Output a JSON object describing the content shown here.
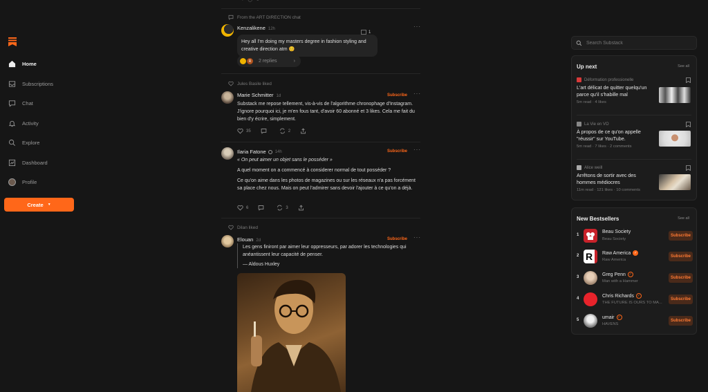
{
  "colors": {
    "accent": "#ff6719",
    "background": "#161616",
    "card": "#1c1c1c"
  },
  "nav": {
    "items": [
      {
        "label": "Home",
        "icon": "home-icon"
      },
      {
        "label": "Subscriptions",
        "icon": "inbox-icon"
      },
      {
        "label": "Chat",
        "icon": "chat-icon"
      },
      {
        "label": "Activity",
        "icon": "bell-icon"
      },
      {
        "label": "Explore",
        "icon": "search-icon"
      },
      {
        "label": "Dashboard",
        "icon": "dashboard-icon"
      },
      {
        "label": "Profile",
        "icon": "avatar"
      }
    ],
    "create_label": "Create",
    "create_caret": "▼"
  },
  "feed": {
    "post1": {
      "context": "From the ART DIRECTION chat",
      "author": "Kenzalikene",
      "time": "12h",
      "badge_count": "1",
      "message": "Hey all I'm doing my masters degree in fashion styling and creative direction atm 😊",
      "replies": "2 replies",
      "reply_avatar_letter": "R"
    },
    "post2": {
      "context": "Jules Basile liked",
      "author": "Marie Schmitter",
      "time": "1d",
      "subscribe": "Subscribe",
      "text": "Substack me repose tellement, vis-à-vis de l'algorithme chronophage d'Instagram. J'ignore pourquoi ici, je m'en fous tant, d'avoir 60 abonné et 3 likes. Cela me fait du bien d'y écrire, simplement.",
      "likes": "35",
      "comments": "",
      "restacks": "2"
    },
    "post3": {
      "author": "Ilaria Fatone",
      "time": "14h",
      "subscribe": "Subscribe",
      "quote": "« On peut aimer un objet sans le posséder »",
      "para1": "A quel moment on a commencé à considerer normal de tout posséder ?",
      "para2": "Ce qu'on aime dans les photos de magazines ou sur les réseaux n'a pas forcément sa place chez nous. Mais on peut l'admirer sans devoir l'ajouter à ce qu'on a déjà.",
      "likes": "6",
      "comments": "",
      "restacks": "3"
    },
    "post4": {
      "context": "Dilan liked",
      "author": "Elouan",
      "time": "2d",
      "subscribe": "Subscribe",
      "quote": "Les gens finiront par aimer leur oppresseurs, par adorer les technologies qui anéantissent leur capacité de penser.",
      "attribution": "— Aldous Huxley"
    }
  },
  "search": {
    "placeholder": "Search Substack"
  },
  "up_next": {
    "title": "Up next",
    "see_all": "See all",
    "items": [
      {
        "pub": "Déformation professionelle",
        "title": "L'art délicat de quitter quelqu'un parce qu'il s'habille mal",
        "stats": "5m read · 4 likes"
      },
      {
        "pub": "La Vie en VO",
        "title": "À propos de ce qu'on appelle \"réussir\" sur YouTube.",
        "stats": "5m read · 7 likes · 2 comments"
      },
      {
        "pub": "Alice weill",
        "title": "Arrêtons de sortir avec des hommes médiocres",
        "stats": "11m read · 121 likes · 10 comments"
      }
    ]
  },
  "bestsellers": {
    "title": "New Bestsellers",
    "see_all": "See all",
    "subscribe": "Subscribe",
    "items": [
      {
        "rank": "1",
        "name": "Beau Society",
        "sub": "Beau Society"
      },
      {
        "rank": "2",
        "name": "Raw America",
        "sub": "Raw America",
        "logo_letter": "R"
      },
      {
        "rank": "3",
        "name": "Greg Penn",
        "sub": "Man with a Hammer"
      },
      {
        "rank": "4",
        "name": "Chris Richards",
        "sub": "THE FUTURE IS OURS TO MA..."
      },
      {
        "rank": "5",
        "name": "umair",
        "sub": "HAVENS"
      }
    ]
  }
}
